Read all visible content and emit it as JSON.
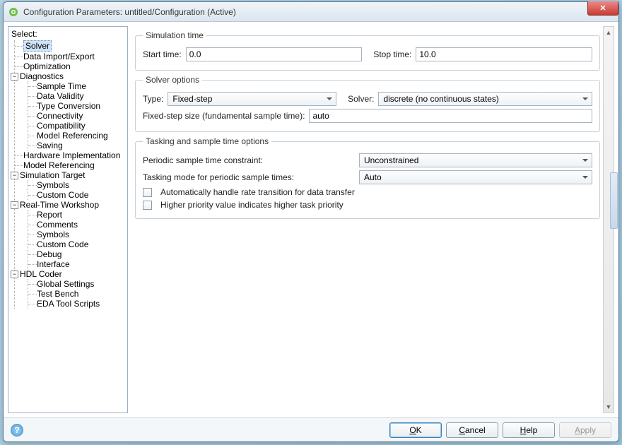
{
  "window": {
    "title": "Configuration Parameters: untitled/Configuration (Active)"
  },
  "tree": {
    "select_label": "Select:",
    "items": {
      "solver": "Solver",
      "data_import": "Data Import/Export",
      "optimization": "Optimization",
      "diagnostics": "Diagnostics",
      "sample_time": "Sample Time",
      "data_validity": "Data Validity",
      "type_conversion": "Type Conversion",
      "connectivity": "Connectivity",
      "compatibility": "Compatibility",
      "model_ref_d": "Model Referencing",
      "saving": "Saving",
      "hw_impl": "Hardware Implementation",
      "model_ref": "Model Referencing",
      "sim_target": "Simulation Target",
      "symbols": "Symbols",
      "custom_code": "Custom Code",
      "rtw": "Real-Time Workshop",
      "report": "Report",
      "comments": "Comments",
      "rtw_symbols": "Symbols",
      "rtw_custom_code": "Custom Code",
      "debug": "Debug",
      "interface": "Interface",
      "hdl_coder": "HDL Coder",
      "global_settings": "Global Settings",
      "test_bench": "Test Bench",
      "eda_tool": "EDA Tool Scripts"
    }
  },
  "groups": {
    "sim_time": {
      "legend": "Simulation time",
      "start_label": "Start time:",
      "start_value": "0.0",
      "stop_label": "Stop time:",
      "stop_value": "10.0"
    },
    "solver_opts": {
      "legend": "Solver options",
      "type_label": "Type:",
      "type_value": "Fixed-step",
      "solver_label": "Solver:",
      "solver_value": "discrete (no continuous states)",
      "step_label": "Fixed-step size (fundamental sample time):",
      "step_value": "auto"
    },
    "tasking": {
      "legend": "Tasking and sample time options",
      "periodic_label": "Periodic sample time constraint:",
      "periodic_value": "Unconstrained",
      "tasking_mode_label": "Tasking mode for periodic sample times:",
      "tasking_mode_value": "Auto",
      "chk_rate": "Automatically handle rate transition for data transfer",
      "chk_priority": "Higher priority value indicates higher task priority"
    }
  },
  "footer": {
    "ok": "OK",
    "cancel": "Cancel",
    "help": "Help",
    "apply": "Apply"
  }
}
